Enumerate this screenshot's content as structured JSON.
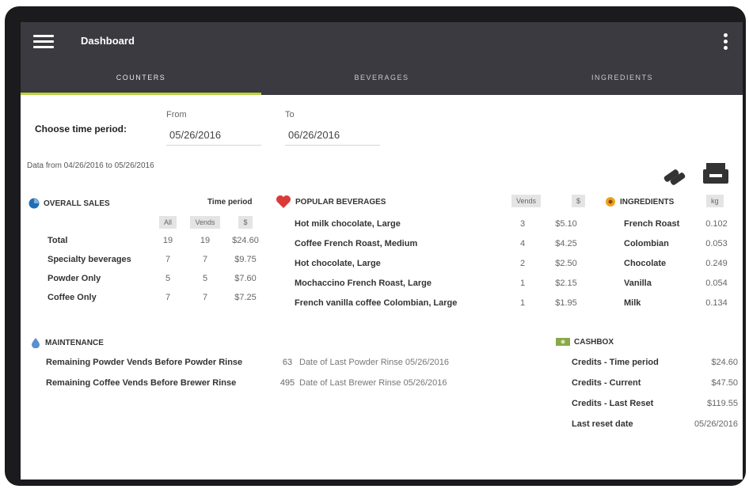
{
  "app": {
    "title": "Dashboard"
  },
  "tabs": [
    {
      "label": "COUNTERS",
      "active": true
    },
    {
      "label": "BEVERAGES",
      "active": false
    },
    {
      "label": "INGREDIENTS",
      "active": false
    }
  ],
  "period": {
    "label": "Choose time period:",
    "from_label": "From",
    "from_value": "05/26/2016",
    "to_label": "To",
    "to_value": "06/26/2016",
    "range_note": "Data from 04/26/2016 to 05/26/2016"
  },
  "overall_sales": {
    "title": "OVERALL SALES",
    "time_period_label": "Time period",
    "columns": [
      "All",
      "Vends",
      "$"
    ],
    "rows": [
      {
        "label": "Total",
        "all": "19",
        "vends": "19",
        "amount": "$24.60"
      },
      {
        "label": "Specialty beverages",
        "all": "7",
        "vends": "7",
        "amount": "$9.75"
      },
      {
        "label": "Powder Only",
        "all": "5",
        "vends": "5",
        "amount": "$7.60"
      },
      {
        "label": "Coffee Only",
        "all": "7",
        "vends": "7",
        "amount": "$7.25"
      }
    ]
  },
  "popular_beverages": {
    "title": "POPULAR BEVERAGES",
    "columns": [
      "Vends",
      "$"
    ],
    "rows": [
      {
        "name": "Hot milk chocolate, Large",
        "vends": "3",
        "amount": "$5.10"
      },
      {
        "name": "Coffee French Roast, Medium",
        "vends": "4",
        "amount": "$4.25"
      },
      {
        "name": "Hot chocolate, Large",
        "vends": "2",
        "amount": "$2.50"
      },
      {
        "name": "Mochaccino French Roast, Large",
        "vends": "1",
        "amount": "$2.15"
      },
      {
        "name": "French vanilla coffee Colombian, Large",
        "vends": "1",
        "amount": "$1.95"
      }
    ]
  },
  "ingredients": {
    "title": "INGREDIENTS",
    "unit": "kg",
    "rows": [
      {
        "name": "French Roast",
        "value": "0.102"
      },
      {
        "name": "Colombian",
        "value": "0.053"
      },
      {
        "name": "Chocolate",
        "value": "0.249"
      },
      {
        "name": "Vanilla",
        "value": "0.054"
      },
      {
        "name": "Milk",
        "value": "0.134"
      }
    ]
  },
  "maintenance": {
    "title": "MAINTENANCE",
    "rows": [
      {
        "label": "Remaining Powder Vends Before Powder Rinse",
        "value": "63",
        "date_text": "Date of Last Powder Rinse 05/26/2016"
      },
      {
        "label": "Remaining Coffee Vends Before Brewer Rinse",
        "value": "495",
        "date_text": "Date of Last Brewer Rinse 05/26/2016"
      }
    ]
  },
  "cashbox": {
    "title": "CASHBOX",
    "rows": [
      {
        "label": "Credits - Time period",
        "value": "$24.60"
      },
      {
        "label": "Credits - Current",
        "value": "$47.50"
      },
      {
        "label": "Credits - Last Reset",
        "value": "$119.55"
      },
      {
        "label": "Last reset date",
        "value": "05/26/2016"
      }
    ]
  },
  "colors": {
    "appbar": "#3a3a40",
    "tab_indicator": "#b8d33a",
    "heart": "#d93a3a",
    "globe_blue": "#1f6fb5",
    "ingredient_orange": "#f0a020",
    "drop_blue": "#5a8fd0",
    "cash_green": "#8aa84a"
  },
  "icons": {
    "menu": "hamburger-icon",
    "more": "more-vert-icon",
    "clean": "clean-icon",
    "print": "print-icon"
  }
}
